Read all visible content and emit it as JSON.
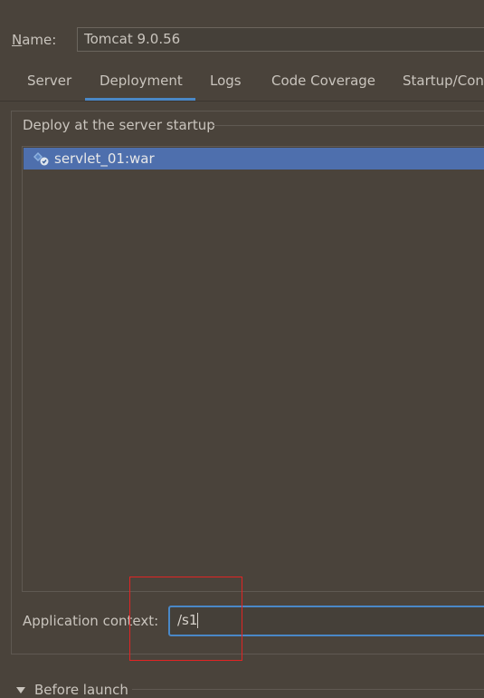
{
  "name_field": {
    "label_mnemonic": "N",
    "label_rest": "ame:",
    "value": "Tomcat 9.0.56"
  },
  "tabs": [
    {
      "label": "Server",
      "active": false
    },
    {
      "label": "Deployment",
      "active": true
    },
    {
      "label": "Logs",
      "active": false
    },
    {
      "label": "Code Coverage",
      "active": false
    },
    {
      "label": "Startup/Con",
      "active": false
    }
  ],
  "deploy": {
    "title": "Deploy at the server startup",
    "items": [
      {
        "label": "servlet_01:war",
        "icon": "artifact-icon",
        "selected": true
      }
    ]
  },
  "context": {
    "label": "Application context:",
    "value": "/s1"
  },
  "before_launch": {
    "label": "Before launch"
  },
  "colors": {
    "background": "#4a433b",
    "selection": "#4e6fad",
    "accent": "#4a88c7",
    "annotation": "#e02424"
  }
}
